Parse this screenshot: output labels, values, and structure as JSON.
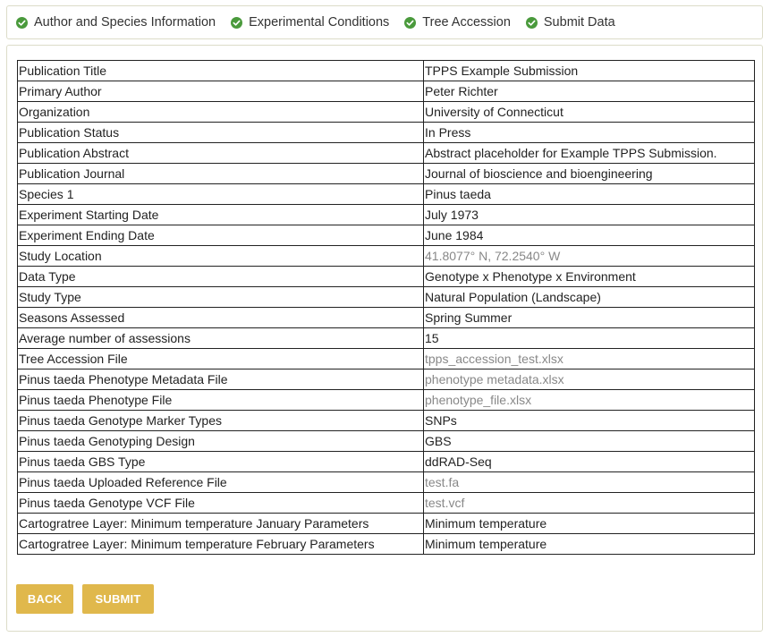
{
  "steps": [
    {
      "label": "Author and Species Information",
      "icon": "check-circle-icon"
    },
    {
      "label": "Experimental Conditions",
      "icon": "check-circle-icon"
    },
    {
      "label": "Tree Accession",
      "icon": "check-circle-icon"
    },
    {
      "label": "Submit Data",
      "icon": "check-circle-icon"
    }
  ],
  "colors": {
    "step_check": "#4a9a3c",
    "button": "#e0b84c",
    "muted_text": "#888888"
  },
  "review": {
    "rows": [
      {
        "label": "Publication Title",
        "value": "TPPS Example Submission"
      },
      {
        "label": "Primary Author",
        "value": "Peter Richter"
      },
      {
        "label": "Organization",
        "value": "University of Connecticut"
      },
      {
        "label": "Publication Status",
        "value": "In Press"
      },
      {
        "label": "Publication Abstract",
        "value": "Abstract placeholder for Example TPPS Submission."
      },
      {
        "label": "Publication Journal",
        "value": "Journal of bioscience and bioengineering"
      },
      {
        "label": "Species 1",
        "value": "Pinus taeda"
      },
      {
        "label": "Experiment Starting Date",
        "value": "July 1973"
      },
      {
        "label": "Experiment Ending Date",
        "value": "June 1984"
      },
      {
        "label": "Study Location",
        "value": "41.8077° N, 72.2540° W"
      },
      {
        "label": "Data Type",
        "value": "Genotype x Phenotype x Environment"
      },
      {
        "label": "Study Type",
        "value": "Natural Population (Landscape)"
      },
      {
        "label": "Seasons Assessed",
        "value": "Spring Summer"
      },
      {
        "label": "Average number of assessions",
        "value": "15"
      },
      {
        "label": "Tree Accession File",
        "value": "tpps_accession_test.xlsx"
      },
      {
        "label": "Pinus taeda Phenotype Metadata File",
        "value": "phenotype metadata.xlsx"
      },
      {
        "label": "Pinus taeda Phenotype File",
        "value": "phenotype_file.xlsx"
      },
      {
        "label": "Pinus taeda Genotype Marker Types",
        "value": "SNPs"
      },
      {
        "label": "Pinus taeda Genotyping Design",
        "value": "GBS"
      },
      {
        "label": "Pinus taeda GBS Type",
        "value": "ddRAD-Seq"
      },
      {
        "label": "Pinus taeda Uploaded Reference File",
        "value": "test.fa"
      },
      {
        "label": "Pinus taeda Genotype VCF File",
        "value": "test.vcf"
      },
      {
        "label": "Cartogratree Layer: Minimum temperature January Parameters",
        "value": "Minimum temperature"
      },
      {
        "label": "Cartogratree Layer: Minimum temperature February Parameters",
        "value": "Minimum temperature"
      }
    ]
  },
  "buttons": {
    "back_label": "BACK",
    "submit_label": "SUBMIT"
  }
}
